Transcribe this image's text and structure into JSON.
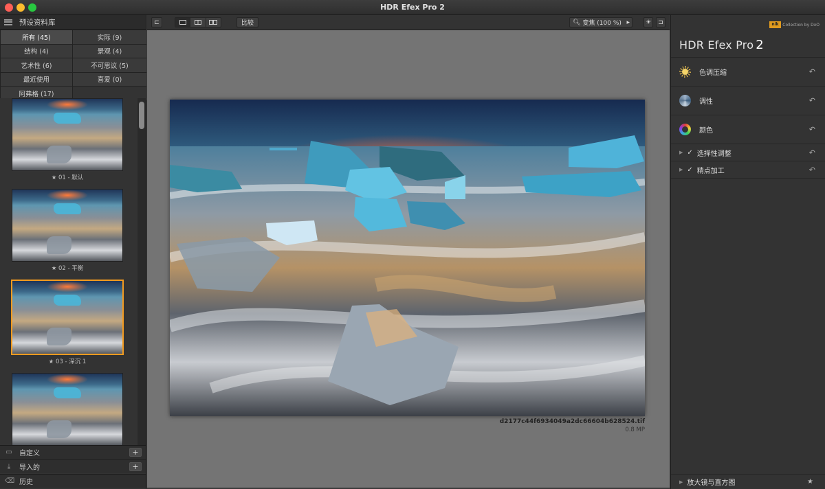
{
  "window": {
    "title": "HDR Efex Pro 2"
  },
  "left_panel": {
    "header": "预设资料库",
    "categories": [
      {
        "label": "所有 (45)",
        "selected": true
      },
      {
        "label": "实际 (9)"
      },
      {
        "label": "结构 (4)"
      },
      {
        "label": "景观 (4)"
      },
      {
        "label": "艺术性 (6)"
      },
      {
        "label": "不可思议 (5)"
      },
      {
        "label": "最近使用"
      },
      {
        "label": "喜爱 (0)"
      },
      {
        "label": "阿弗格 (17)"
      }
    ],
    "presets": [
      {
        "caption": "★ 01 - 默认"
      },
      {
        "caption": "★ 02 - 平衡"
      },
      {
        "caption": "★ 03 - 深沉 1",
        "selected": true
      },
      {
        "caption": ""
      }
    ],
    "bottom": [
      {
        "label": "自定义",
        "icon": "folder-icon",
        "action": "+"
      },
      {
        "label": "导入的",
        "icon": "download-icon",
        "action": "+"
      },
      {
        "label": "历史",
        "icon": "history-icon"
      }
    ]
  },
  "toolbar": {
    "compare_label": "比较",
    "zoom_label": "变焦 (100 %)",
    "zoom_arrow": "▸"
  },
  "image": {
    "filename": "d2177c44f6934049a2dc66604b628524.tif",
    "size": "0.8 MP"
  },
  "right_panel": {
    "brand_badge": "nik",
    "brand_sub": "Collection by DxO",
    "product": "HDR Efex Pro",
    "product_version": "2",
    "sections": [
      {
        "label": "色调压缩",
        "icon": "sun-icon"
      },
      {
        "label": "调性",
        "icon": "tonality-icon"
      },
      {
        "label": "颜色",
        "icon": "color-wheel-icon"
      }
    ],
    "subsections": [
      {
        "label": "选择性调整"
      },
      {
        "label": "精点加工"
      }
    ],
    "footer": "放大镜与直方图",
    "undo_glyph": "↶",
    "check_glyph": "✓",
    "collapse_glyph": "▶",
    "star_glyph": "★"
  },
  "colors": {
    "accent_selected": "#f39b1f",
    "panel_bg": "#333333",
    "canvas_bg": "#747474"
  }
}
